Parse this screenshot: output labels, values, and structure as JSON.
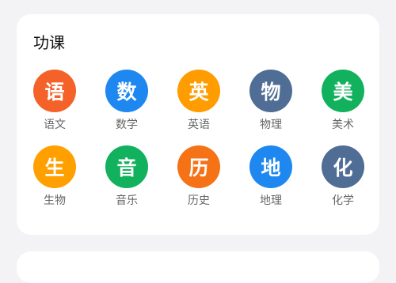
{
  "section": {
    "title": "功课"
  },
  "subjects": [
    {
      "glyph": "语",
      "label": "语文",
      "color": "#f4622a",
      "icon": "chinese-icon"
    },
    {
      "glyph": "数",
      "label": "数学",
      "color": "#1e88f0",
      "icon": "math-icon"
    },
    {
      "glyph": "英",
      "label": "英语",
      "color": "#ff9c00",
      "icon": "english-icon"
    },
    {
      "glyph": "物",
      "label": "物理",
      "color": "#4f6d95",
      "icon": "physics-icon"
    },
    {
      "glyph": "美",
      "label": "美术",
      "color": "#12b15d",
      "icon": "art-icon"
    },
    {
      "glyph": "生",
      "label": "生物",
      "color": "#ffa000",
      "icon": "biology-icon"
    },
    {
      "glyph": "音",
      "label": "音乐",
      "color": "#12b15d",
      "icon": "music-icon"
    },
    {
      "glyph": "历",
      "label": "历史",
      "color": "#f57216",
      "icon": "history-icon"
    },
    {
      "glyph": "地",
      "label": "地理",
      "color": "#1e88f0",
      "icon": "geography-icon"
    },
    {
      "glyph": "化",
      "label": "化学",
      "color": "#4f6d95",
      "icon": "chemistry-icon"
    }
  ]
}
